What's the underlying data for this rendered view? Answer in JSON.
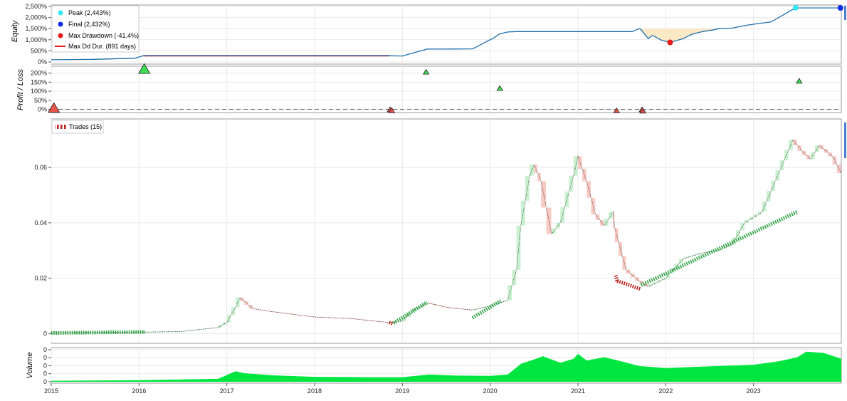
{
  "colors": {
    "equity_line": "#1f6fa8",
    "drawdown_fill": "#fbe9c6",
    "peak": "#33e6f0",
    "final": "#0b2ee6",
    "max_drawdown": "#e41a1c",
    "max_dd_duration": "#e41a1c",
    "profit_marker": "#3ddc55",
    "loss_marker": "#e8564a",
    "candle_up": "#c9f0cf",
    "candle_down": "#f9c9c3",
    "trade_win": "#2ea043",
    "trade_loss": "#b5201a",
    "volume": "#00e640",
    "grid": "#e8e8e8"
  },
  "chart_data": [
    {
      "type": "line",
      "ylabel": "Equity",
      "ylim": [
        0,
        2500
      ],
      "y_ticks": [
        "0%",
        "500%",
        "1,000%",
        "1,500%",
        "2,000%",
        "2,500%"
      ],
      "series": [
        {
          "x": [
            2015.0,
            2015.5,
            2015.95,
            2016.05,
            2016.5,
            2017.0,
            2017.5,
            2018.0,
            2018.5,
            2018.85,
            2019.0,
            2019.1,
            2019.28,
            2019.5,
            2019.8,
            2019.95,
            2020.05,
            2020.1,
            2020.2,
            2020.3,
            2020.6,
            2021.0,
            2021.4,
            2021.55,
            2021.62,
            2021.7,
            2021.72,
            2021.8,
            2021.85,
            2021.95,
            2022.05,
            2022.2,
            2022.3,
            2022.4,
            2022.5,
            2022.55,
            2022.6,
            2022.75,
            2022.85,
            2022.92,
            2023.0,
            2023.2,
            2023.48,
            2023.5,
            2023.6,
            2023.9,
            2024.0
          ],
          "y": [
            100,
            120,
            170,
            280,
            280,
            280,
            280,
            280,
            280,
            280,
            270,
            380,
            580,
            580,
            590,
            900,
            1100,
            1250,
            1350,
            1370,
            1370,
            1370,
            1370,
            1370,
            1370,
            1500,
            1450,
            1050,
            1200,
            980,
            880,
            1050,
            1250,
            1350,
            1420,
            1450,
            1500,
            1520,
            1600,
            1650,
            1700,
            1800,
            2440,
            2432,
            2432,
            2432,
            2432
          ]
        }
      ]
    },
    {
      "type": "scatter",
      "ylabel": "Profit / Loss",
      "ylim": [
        -10,
        230
      ],
      "y_ticks": [
        "0%",
        "50%",
        "100%",
        "150%",
        "200%"
      ],
      "points": [
        {
          "x": 2015.03,
          "y": 5
        },
        {
          "x": 2016.06,
          "y": 220
        },
        {
          "x": 2018.86,
          "y": -3
        },
        {
          "x": 2018.88,
          "y": -8
        },
        {
          "x": 2019.27,
          "y": 205
        },
        {
          "x": 2020.11,
          "y": 115
        },
        {
          "x": 2021.44,
          "y": -8
        },
        {
          "x": 2021.73,
          "y": -3
        },
        {
          "x": 2021.74,
          "y": -10
        },
        {
          "x": 2023.52,
          "y": 155
        }
      ]
    },
    {
      "type": "candlestick",
      "legend": "Trades (15)",
      "ylim": [
        -0.003,
        0.077
      ],
      "y_ticks": [
        "0",
        "0.02",
        "0.04",
        "0.06"
      ],
      "price": {
        "x": [
          2015.0,
          2015.5,
          2016.0,
          2016.5,
          2016.9,
          2017.0,
          2017.1,
          2017.15,
          2017.3,
          2017.5,
          2017.8,
          2018.0,
          2018.4,
          2018.85,
          2019.0,
          2019.15,
          2019.3,
          2019.5,
          2019.8,
          2020.0,
          2020.2,
          2020.3,
          2020.35,
          2020.45,
          2020.5,
          2020.58,
          2020.7,
          2020.8,
          2020.95,
          2021.0,
          2021.1,
          2021.2,
          2021.3,
          2021.4,
          2021.42,
          2021.55,
          2021.7,
          2021.8,
          2022.0,
          2022.2,
          2022.4,
          2022.6,
          2022.75,
          2022.9,
          2023.1,
          2023.3,
          2023.45,
          2023.55,
          2023.65,
          2023.75,
          2023.9,
          2024.0
        ],
        "y": [
          0.0003,
          0.0004,
          0.0005,
          0.0008,
          0.0022,
          0.004,
          0.0095,
          0.013,
          0.009,
          0.008,
          0.0068,
          0.006,
          0.0055,
          0.004,
          0.0045,
          0.009,
          0.011,
          0.0095,
          0.0085,
          0.01,
          0.012,
          0.023,
          0.039,
          0.057,
          0.061,
          0.055,
          0.036,
          0.04,
          0.057,
          0.064,
          0.055,
          0.043,
          0.039,
          0.044,
          0.038,
          0.023,
          0.019,
          0.017,
          0.02,
          0.027,
          0.029,
          0.03,
          0.032,
          0.04,
          0.044,
          0.059,
          0.07,
          0.066,
          0.063,
          0.068,
          0.064,
          0.058
        ]
      },
      "trades": [
        {
          "x0": 2015.0,
          "y0": 0.0002,
          "x1": 2016.07,
          "y1": 0.0006,
          "result": "win"
        },
        {
          "x0": 2018.85,
          "y0": 0.004,
          "x1": 2018.9,
          "y1": 0.0035,
          "result": "loss"
        },
        {
          "x0": 2018.9,
          "y0": 0.0038,
          "x1": 2019.28,
          "y1": 0.0113,
          "result": "win"
        },
        {
          "x0": 2019.8,
          "y0": 0.0057,
          "x1": 2020.12,
          "y1": 0.0118,
          "result": "win"
        },
        {
          "x0": 2021.43,
          "y0": 0.021,
          "x1": 2021.45,
          "y1": 0.0185,
          "result": "loss"
        },
        {
          "x0": 2021.45,
          "y0": 0.019,
          "x1": 2021.72,
          "y1": 0.016,
          "result": "loss"
        },
        {
          "x0": 2021.72,
          "y0": 0.0175,
          "x1": 2023.5,
          "y1": 0.044,
          "result": "win"
        }
      ]
    },
    {
      "type": "area",
      "ylabel": "Volume",
      "ylim": [
        0,
        1
      ],
      "y_ticks": [
        "0",
        "0",
        "0",
        "0",
        "0"
      ],
      "x_ticks": [
        "2015",
        "2016",
        "2017",
        "2018",
        "2019",
        "2020",
        "2021",
        "2022",
        "2023"
      ],
      "series": [
        {
          "x": [
            2015.0,
            2016.0,
            2016.9,
            2017.1,
            2017.2,
            2017.5,
            2018.0,
            2018.6,
            2019.0,
            2019.3,
            2019.6,
            2020.0,
            2020.2,
            2020.35,
            2020.5,
            2020.6,
            2020.8,
            2020.95,
            2021.0,
            2021.1,
            2021.3,
            2021.5,
            2021.7,
            2022.0,
            2022.3,
            2022.6,
            2023.0,
            2023.3,
            2023.5,
            2023.6,
            2023.8,
            2024.0
          ],
          "y": [
            0.03,
            0.05,
            0.09,
            0.32,
            0.26,
            0.2,
            0.15,
            0.14,
            0.14,
            0.22,
            0.19,
            0.18,
            0.22,
            0.55,
            0.68,
            0.78,
            0.58,
            0.7,
            0.85,
            0.65,
            0.75,
            0.62,
            0.48,
            0.42,
            0.45,
            0.48,
            0.52,
            0.63,
            0.75,
            0.92,
            0.88,
            0.7
          ]
        }
      ]
    }
  ],
  "legend": {
    "peak": "Peak (2,443%)",
    "final": "Final (2,432%)",
    "max_drawdown": "Max Drawdown (-41.4%)",
    "max_dd_duration": "Max Dd Dur. (891 days)"
  }
}
